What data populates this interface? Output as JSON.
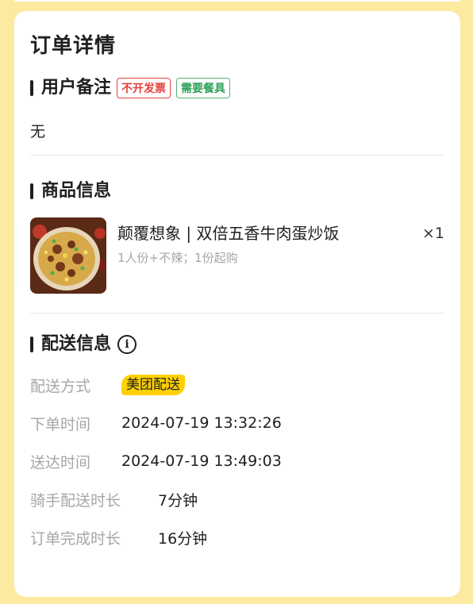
{
  "card": {
    "title": "订单详情"
  },
  "remark_section": {
    "title": "用户备注",
    "tags": [
      "不开发票",
      "需要餐具"
    ],
    "content": "无"
  },
  "product_section": {
    "title": "商品信息",
    "items": [
      {
        "name": "颠覆想象 | 双倍五香牛肉蛋炒饭",
        "quantity": "×1",
        "spec": "1人份+不辣；1份起购",
        "image_icon": "fried-rice-photo"
      }
    ]
  },
  "delivery_section": {
    "title": "配送信息",
    "info_icon": "info-icon",
    "rows": [
      {
        "label": "配送方式",
        "value": "美团配送"
      },
      {
        "label": "下单时间",
        "value": "2024-07-19 13:32:26"
      },
      {
        "label": "送达时间",
        "value": "2024-07-19 13:49:03"
      },
      {
        "label": "骑手配送时长",
        "value": "7分钟"
      },
      {
        "label": "订单完成时长",
        "value": "16分钟"
      }
    ]
  },
  "colors": {
    "page_background": "#fbeaa0",
    "tag_red": "#e2403a",
    "tag_green": "#2fa05a",
    "delivery_badge": "#ffd100",
    "muted_text": "#a6a6a6"
  }
}
